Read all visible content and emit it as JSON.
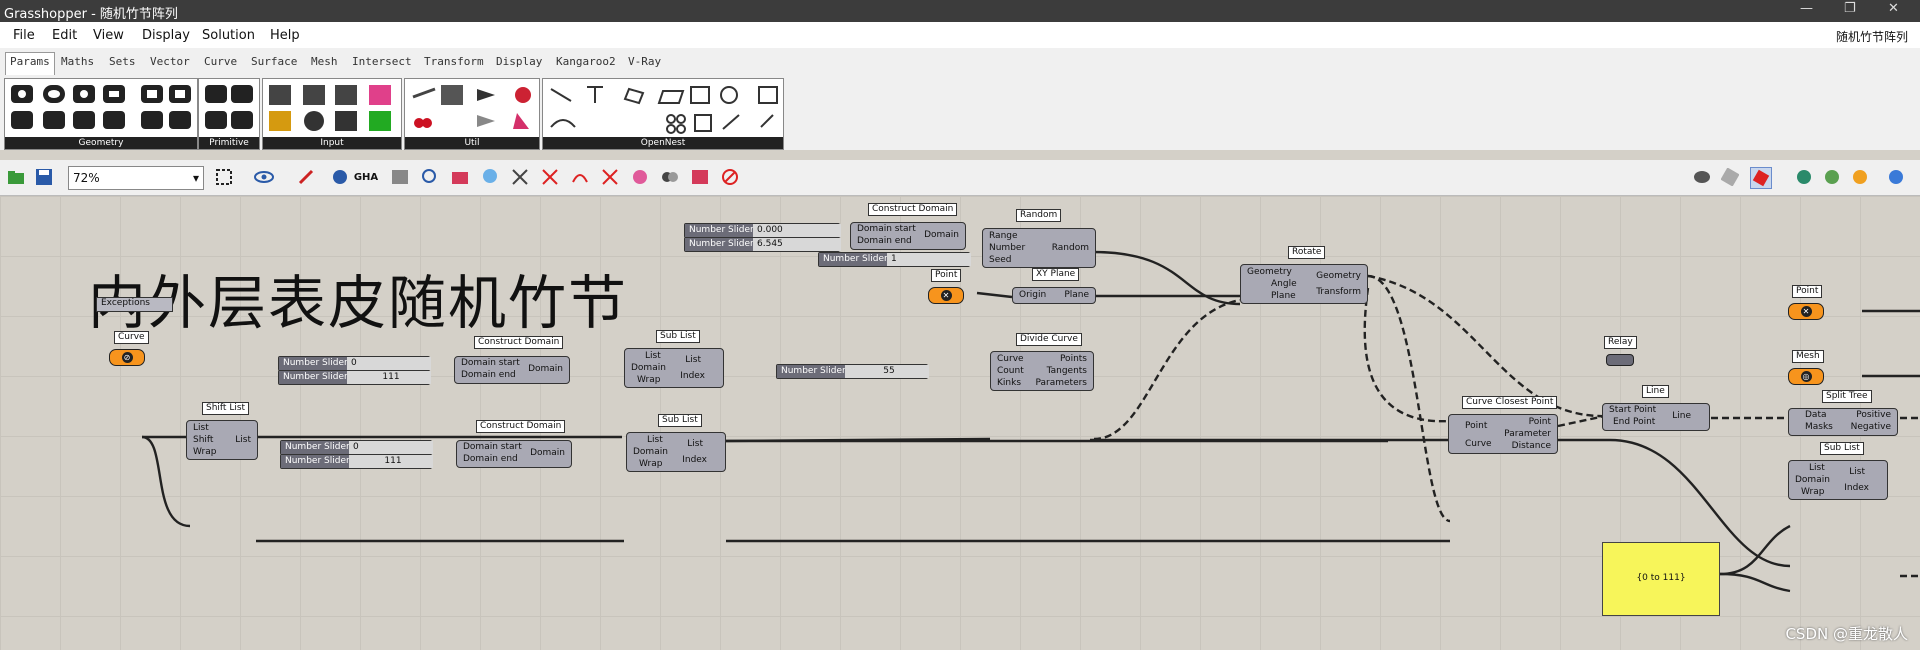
{
  "window": {
    "title": "Grasshopper - 随机竹节阵列",
    "doc_name": "随机竹节阵列"
  },
  "menu": [
    "File",
    "Edit",
    "View",
    "Display",
    "Solution",
    "Help"
  ],
  "tabs": [
    "Params",
    "Maths",
    "Sets",
    "Vector",
    "Curve",
    "Surface",
    "Mesh",
    "Intersect",
    "Transform",
    "Display",
    "Kangaroo2",
    "V-Ray"
  ],
  "ribbon": {
    "groups": [
      "Geometry",
      "Primitive",
      "Input",
      "Util",
      "OpenNest"
    ]
  },
  "toolbar": {
    "zoom": "72%"
  },
  "canvas": {
    "title": "内外层表皮随机竹节",
    "nodes": {
      "exceptions": "Exceptions",
      "curve_label": "Curve",
      "construct_domain_1": {
        "title": "Construct Domain",
        "in": [
          "Domain start",
          "Domain end"
        ],
        "out": "Domain"
      },
      "construct_domain_2": {
        "title": "Construct Domain",
        "in": [
          "Domain start",
          "Domain end"
        ],
        "out": "Domain"
      },
      "construct_domain_3": {
        "title": "Construct Domain",
        "in": [
          "Domain start",
          "Domain end"
        ],
        "out": "Domain"
      },
      "random": {
        "title": "Random",
        "in": [
          "Range",
          "Number",
          "Seed"
        ],
        "out": "Random"
      },
      "rotate": {
        "title": "Rotate",
        "in": [
          "Geometry",
          "Angle",
          "Plane"
        ],
        "out": [
          "Geometry",
          "Transform"
        ]
      },
      "point_1": "Point",
      "xy_plane": {
        "title": "XY Plane",
        "in": "Origin",
        "out": "Plane"
      },
      "sub_list_1": {
        "title": "Sub List",
        "in": [
          "List",
          "Domain",
          "Wrap"
        ],
        "out": [
          "List",
          "Index"
        ]
      },
      "sub_list_2": {
        "title": "Sub List",
        "in": [
          "List",
          "Domain",
          "Wrap"
        ],
        "out": [
          "List",
          "Index"
        ]
      },
      "sub_list_3": {
        "title": "Sub List",
        "in": [
          "List",
          "Domain",
          "Wrap"
        ],
        "out": [
          "List",
          "Index"
        ]
      },
      "shift_list": {
        "title": "Shift List",
        "in": [
          "List",
          "Shift",
          "Wrap"
        ],
        "out": "List"
      },
      "divide_curve": {
        "title": "Divide Curve",
        "in": [
          "Curve",
          "Count",
          "Kinks"
        ],
        "out": [
          "Points",
          "Tangents",
          "Parameters"
        ]
      },
      "relay": "Relay",
      "curve_closest_point": {
        "title": "Curve Closest Point",
        "in": [
          "Point",
          "Curve"
        ],
        "out": [
          "Point",
          "Parameter",
          "Distance"
        ]
      },
      "line": {
        "title": "Line",
        "in": [
          "Start Point",
          "End Point"
        ],
        "out": "Line"
      },
      "split_tree": {
        "title": "Split Tree",
        "in": [
          "Data",
          "Masks"
        ],
        "out": [
          "Positive",
          "Negative"
        ]
      },
      "point_2": "Point",
      "mesh": "Mesh",
      "panel_text": "{0 to 111}"
    },
    "sliders": {
      "s1": {
        "name": "Number Slider",
        "value": "0.000"
      },
      "s2": {
        "name": "Number Slider",
        "value": "6.545"
      },
      "s3": {
        "name": "Number Slider",
        "value": "1"
      },
      "s4": {
        "name": "Number Slider",
        "value": "0"
      },
      "s5": {
        "name": "Number Slider",
        "value": "111"
      },
      "s6": {
        "name": "Number Slider",
        "value": "55"
      },
      "s7": {
        "name": "Number Slider",
        "value": "0"
      },
      "s8": {
        "name": "Number Slider",
        "value": "111"
      }
    }
  },
  "watermark": "CSDN @重龙散人"
}
